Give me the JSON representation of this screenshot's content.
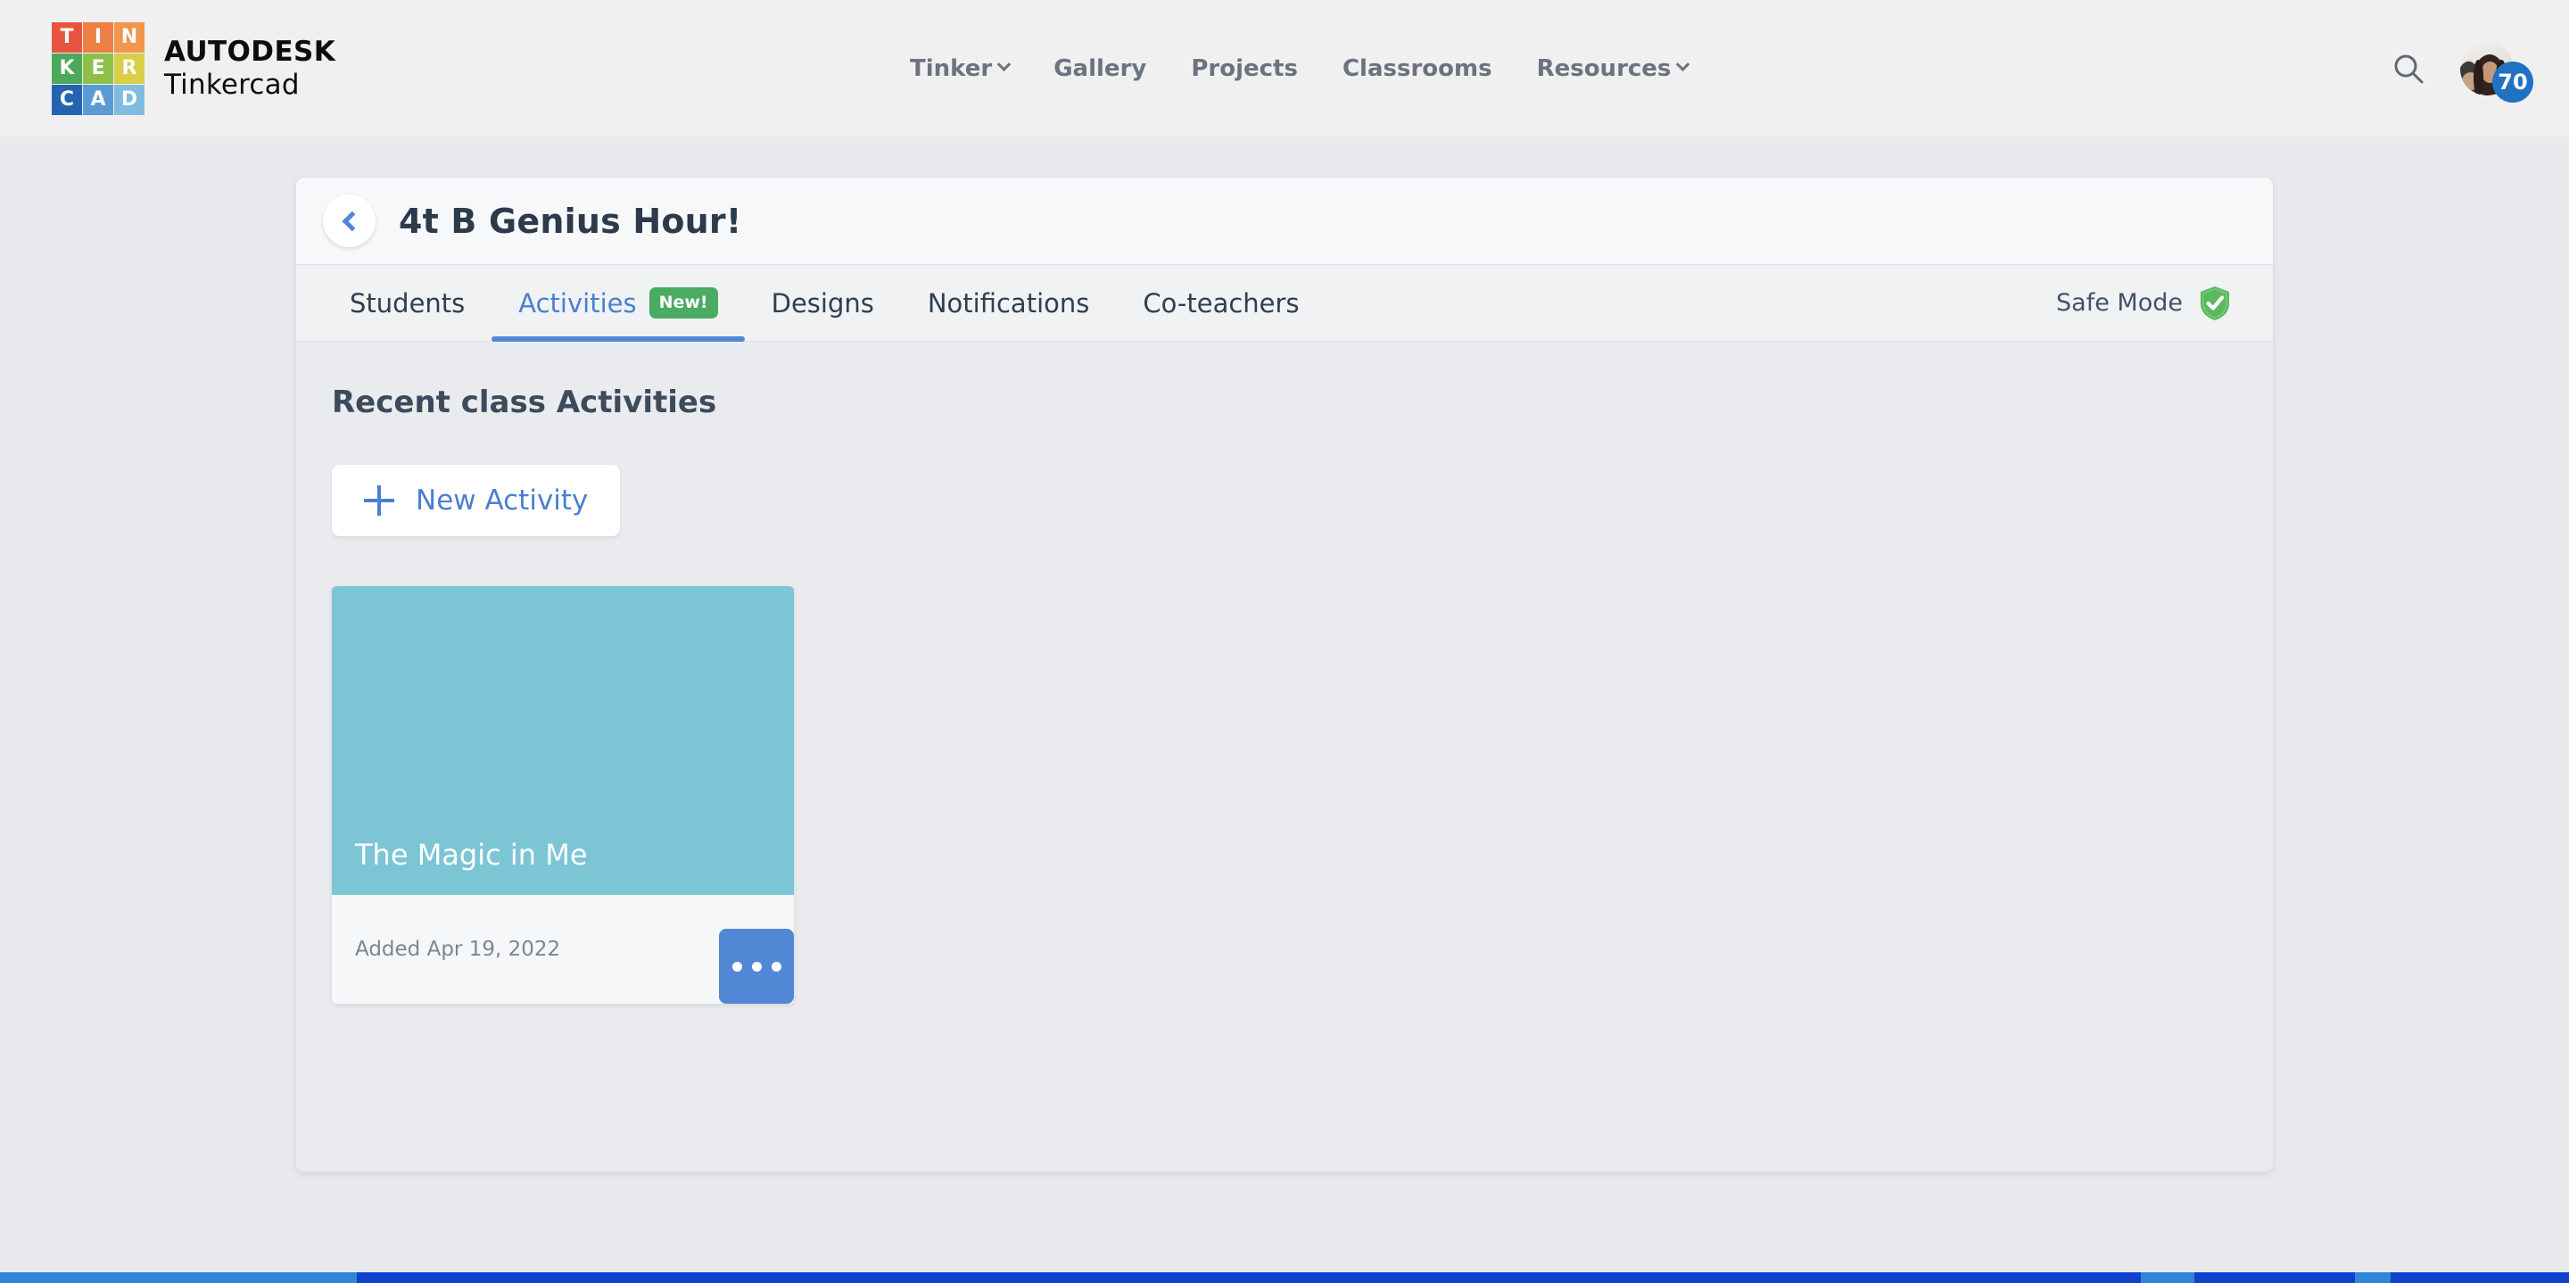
{
  "topbar": {
    "logo": {
      "name": "tinkercad-logo",
      "cells": [
        {
          "letter": "T",
          "color": "#e8543f"
        },
        {
          "letter": "I",
          "color": "#ee7f44"
        },
        {
          "letter": "N",
          "color": "#f0964d"
        },
        {
          "letter": "K",
          "color": "#4ba85c"
        },
        {
          "letter": "E",
          "color": "#8dc04a"
        },
        {
          "letter": "R",
          "color": "#d7ce4a"
        },
        {
          "letter": "C",
          "color": "#2463af"
        },
        {
          "letter": "A",
          "color": "#5a9bd5"
        },
        {
          "letter": "D",
          "color": "#7fbce0"
        }
      ],
      "brand_primary": "AUTODESK",
      "brand_secondary": "Tinkercad"
    },
    "nav_items": [
      {
        "label": "Tinker",
        "has_caret": true
      },
      {
        "label": "Gallery",
        "has_caret": false
      },
      {
        "label": "Projects",
        "has_caret": false
      },
      {
        "label": "Classrooms",
        "has_caret": false
      },
      {
        "label": "Resources",
        "has_caret": true
      }
    ],
    "search_icon": "search-icon",
    "avatar_icon": "user-avatar",
    "notification_count": "70",
    "badge_color": "#2272c4"
  },
  "panel": {
    "back_icon": "chevron-left-icon",
    "title": "4t B Genius Hour!",
    "tabs": [
      {
        "label": "Students",
        "active": false,
        "badge": ""
      },
      {
        "label": "Activities",
        "active": true,
        "badge": "New!"
      },
      {
        "label": "Designs",
        "active": false,
        "badge": ""
      },
      {
        "label": "Notifications",
        "active": false,
        "badge": ""
      },
      {
        "label": "Co-teachers",
        "active": false,
        "badge": ""
      }
    ],
    "safe_mode": {
      "label": "Safe Mode",
      "icon": "shield-check-icon",
      "color": "#5cb85c"
    },
    "content": {
      "section_title": "Recent class Activities",
      "new_activity_label": "New Activity",
      "new_activity_icon": "plus-icon",
      "activities": [
        {
          "title": "The Magic in Me",
          "date": "Added Apr 19, 2022",
          "thumb_color": "#7cc5d4",
          "menu_icon": "ellipsis-icon"
        }
      ]
    }
  },
  "colors": {
    "accent_blue": "#5187d4",
    "link_blue": "#4a7fd0",
    "badge_green": "#4aab63",
    "page_bg": "#e7e9ed",
    "topbar_bg": "#f0f0f0"
  }
}
